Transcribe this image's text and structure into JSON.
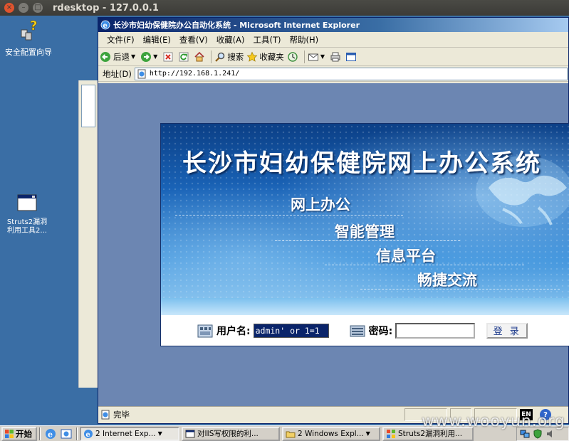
{
  "rdesktop": {
    "title": "rdesktop - 127.0.0.1",
    "close": "×",
    "minimize": "–",
    "maximize": "□"
  },
  "desktop": {
    "icons": [
      {
        "label": "安全配置向导",
        "icon": "security-wizard-icon"
      },
      {
        "label_line1": "Struts2漏洞",
        "label_line2": "利用工具2...",
        "icon": "app-window-icon"
      }
    ]
  },
  "ie": {
    "title": "长沙市妇幼保健院办公自动化系统 - Microsoft Internet Explorer",
    "menu": [
      "文件(F)",
      "编辑(E)",
      "查看(V)",
      "收藏(A)",
      "工具(T)",
      "帮助(H)"
    ],
    "toolbar": {
      "back": "后退",
      "search": "搜索",
      "favorites": "收藏夹"
    },
    "address": {
      "label": "地址(D)",
      "url": "http://192.168.1.241/"
    },
    "status": {
      "text": "完毕",
      "lang": "EN",
      "help": "?"
    }
  },
  "page": {
    "banner_title": "长沙市妇幼保健院网上办公系统",
    "slogans": [
      "网上办公",
      "智能管理",
      "信息平台",
      "畅捷交流"
    ],
    "login": {
      "username_label": "用户名:",
      "username_value": "admin' or 1=1",
      "password_label": "密码:",
      "submit": "登 录"
    }
  },
  "taskbar": {
    "start": "开始",
    "tasks": [
      {
        "label": "2 Internet Exp...",
        "active": true
      },
      {
        "label": "对IIS写权限的利...",
        "active": false
      },
      {
        "label": "2 Windows Expl...",
        "active": false
      },
      {
        "label": "Struts2漏洞利用...",
        "active": false
      }
    ]
  },
  "watermark": "www.wooyun.org",
  "colors": {
    "desktop": "#3a6ea5",
    "ie_title": "#0a246a",
    "banner": "#1a64b8"
  }
}
